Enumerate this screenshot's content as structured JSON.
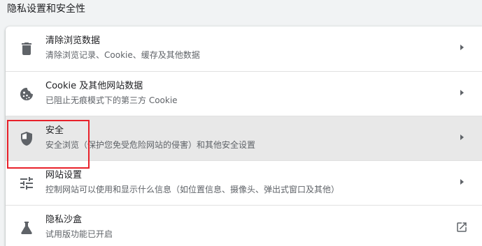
{
  "section": {
    "title": "隐私设置和安全性"
  },
  "rows": [
    {
      "title": "清除浏览数据",
      "subtitle": "清除浏览记录、Cookie、缓存及其他数据",
      "icon": "trash-icon"
    },
    {
      "title": "Cookie 及其他网站数据",
      "subtitle": "已阻止无痕模式下的第三方 Cookie",
      "icon": "cookie-icon"
    },
    {
      "title": "安全",
      "subtitle": "安全浏览（保护您免受危险网站的侵害）和其他安全设置",
      "icon": "shield-icon"
    },
    {
      "title": "网站设置",
      "subtitle": "控制网站可以使用和显示什么信息（如位置信息、摄像头、弹出式窗口及其他）",
      "icon": "tune-icon"
    },
    {
      "title": "隐私沙盒",
      "subtitle": "试用版功能已开启",
      "icon": "flask-icon"
    }
  ],
  "colors": {
    "highlight_border": "#e8212a",
    "hover_row": "#e8e8e8",
    "icon": "#5f6368"
  }
}
